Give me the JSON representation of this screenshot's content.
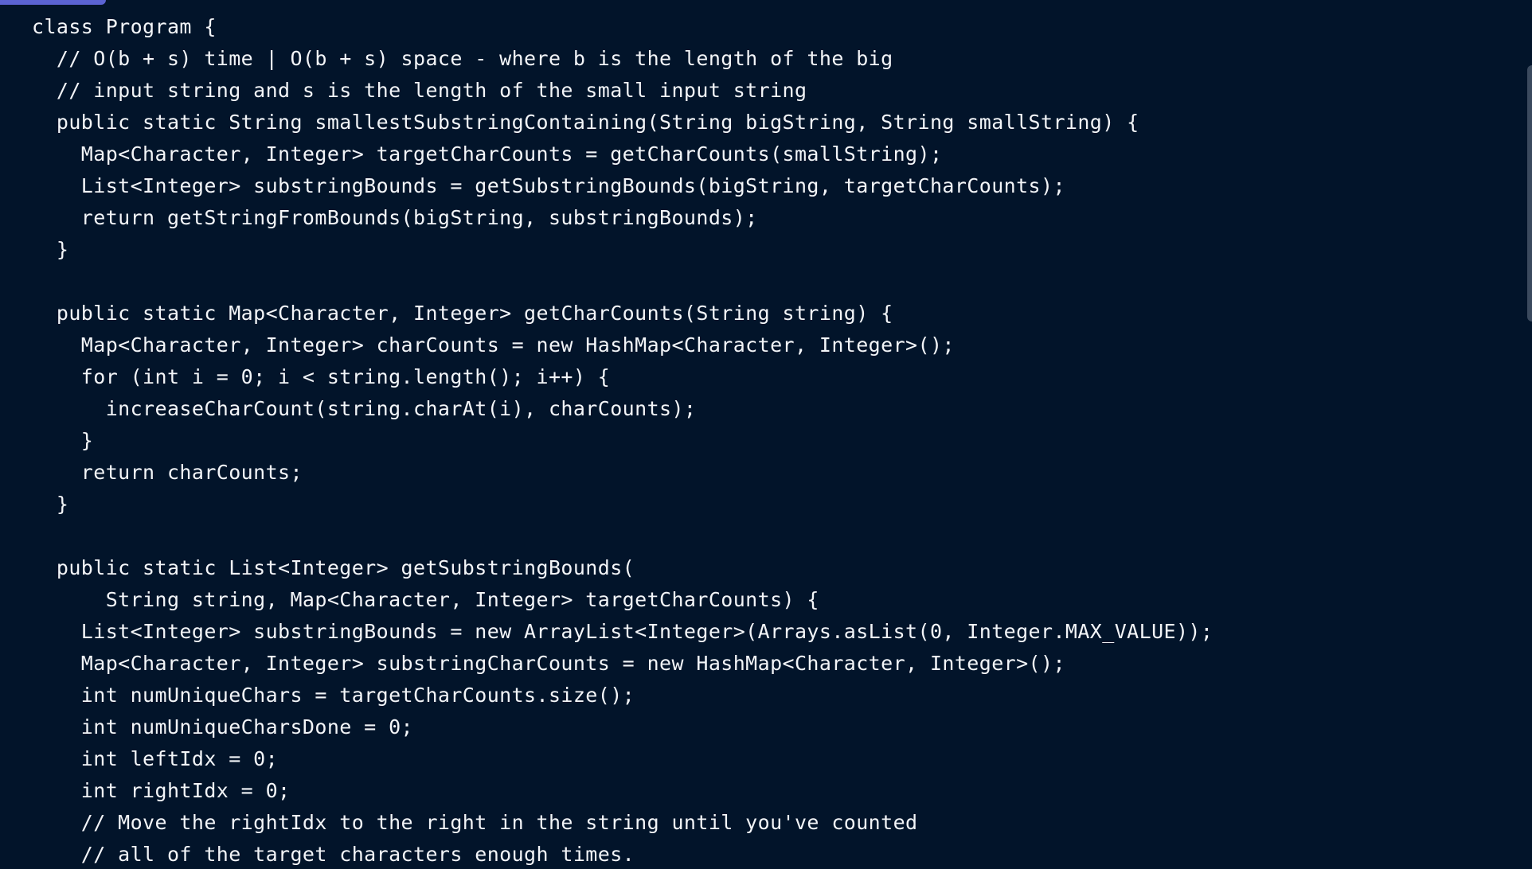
{
  "editor": {
    "lines": [
      "class Program {",
      "  // O(b + s) time | O(b + s) space - where b is the length of the big",
      "  // input string and s is the length of the small input string",
      "  public static String smallestSubstringContaining(String bigString, String smallString) {",
      "    Map<Character, Integer> targetCharCounts = getCharCounts(smallString);",
      "    List<Integer> substringBounds = getSubstringBounds(bigString, targetCharCounts);",
      "    return getStringFromBounds(bigString, substringBounds);",
      "  }",
      "",
      "  public static Map<Character, Integer> getCharCounts(String string) {",
      "    Map<Character, Integer> charCounts = new HashMap<Character, Integer>();",
      "    for (int i = 0; i < string.length(); i++) {",
      "      increaseCharCount(string.charAt(i), charCounts);",
      "    }",
      "    return charCounts;",
      "  }",
      "",
      "  public static List<Integer> getSubstringBounds(",
      "      String string, Map<Character, Integer> targetCharCounts) {",
      "    List<Integer> substringBounds = new ArrayList<Integer>(Arrays.asList(0, Integer.MAX_VALUE));",
      "    Map<Character, Integer> substringCharCounts = new HashMap<Character, Integer>();",
      "    int numUniqueChars = targetCharCounts.size();",
      "    int numUniqueCharsDone = 0;",
      "    int leftIdx = 0;",
      "    int rightIdx = 0;",
      "    // Move the rightIdx to the right in the string until you've counted",
      "    // all of the target characters enough times."
    ]
  },
  "theme": {
    "background": "#02142a",
    "text": "#f3f5f8",
    "accent": "#5b63d3",
    "scrollbar": "#3b4a5e"
  }
}
